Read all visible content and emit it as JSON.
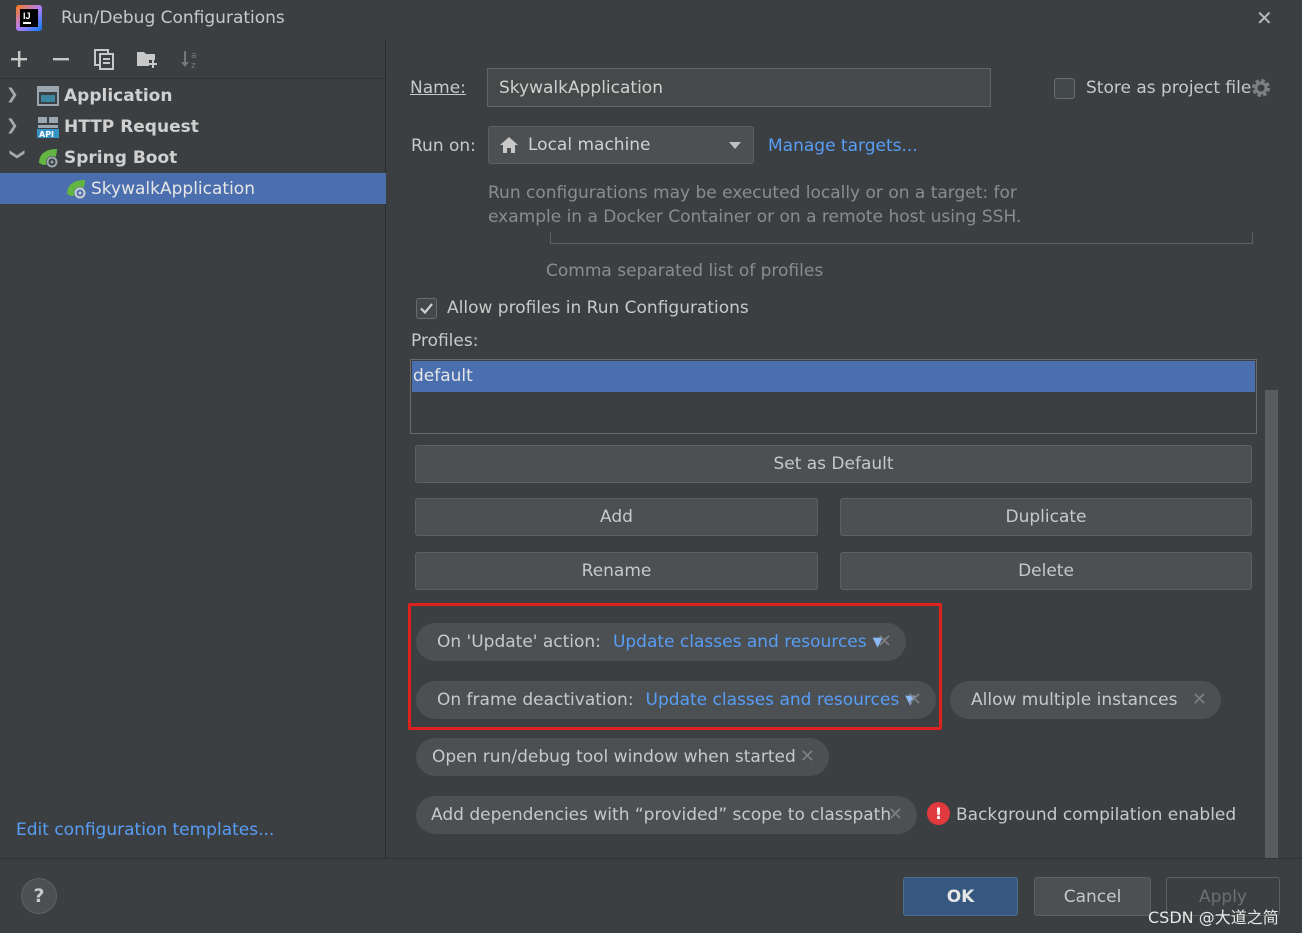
{
  "window": {
    "title": "Run/Debug Configurations"
  },
  "tree": {
    "items": [
      {
        "label": "Application",
        "icon": "application-icon",
        "expanded": false
      },
      {
        "label": "HTTP Request",
        "icon": "api-icon",
        "expanded": false
      },
      {
        "label": "Spring Boot",
        "icon": "spring-boot-icon",
        "expanded": true
      },
      {
        "label": "SkywalkApplication",
        "icon": "spring-boot-app-icon",
        "selected": true
      }
    ],
    "edit_templates": "Edit configuration templates..."
  },
  "form": {
    "name_label": "Name:",
    "name_value": "SkywalkApplication",
    "store_label": "Store as project file",
    "run_on_label": "Run on:",
    "run_on_value": "Local machine",
    "manage_targets": "Manage targets...",
    "run_on_hint_1": "Run configurations may be executed locally or on a target: for",
    "run_on_hint_2": "example in a Docker Container or on a remote host using SSH.",
    "profiles_hint": "Comma separated list of profiles",
    "allow_profiles": "Allow profiles in Run Configurations",
    "profiles_label": "Profiles:",
    "profiles": [
      "default"
    ],
    "set_default": "Set as Default",
    "add": "Add",
    "duplicate": "Duplicate",
    "rename": "Rename",
    "delete": "Delete"
  },
  "chips": {
    "update_action_label": "On 'Update' action:",
    "update_action_value": "Update classes and resources",
    "frame_deactivation_label": "On frame deactivation:",
    "frame_deactivation_value": "Update classes and resources",
    "allow_multiple": "Allow multiple instances",
    "open_tool_window": "Open run/debug tool window when started",
    "add_dependencies": "Add dependencies with “provided” scope to classpath",
    "background_compilation": "Background compilation enabled"
  },
  "footer": {
    "help": "?",
    "ok": "OK",
    "cancel": "Cancel",
    "apply": "Apply"
  },
  "watermark": "CSDN @大道之简",
  "colors": {
    "accent": "#589df6",
    "selection": "#4b6eaf",
    "highlight_box": "#e0221e",
    "error": "#e0393e"
  }
}
